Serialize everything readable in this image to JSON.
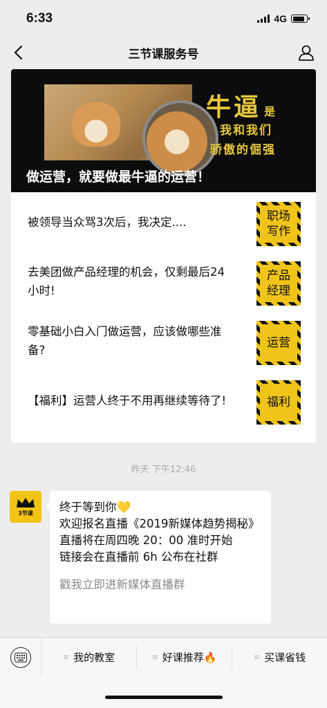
{
  "status_bar": {
    "time": "6:33",
    "network": "4G",
    "battery_level": 0.85
  },
  "nav": {
    "title": "三节课服务号",
    "back_icon": "chevron-left-icon",
    "profile_icon": "person-icon"
  },
  "banner": {
    "big_text": "牛逼",
    "shi": "是",
    "line1": "我和我们",
    "line2": "骄傲的倔强",
    "caption": "做运营，就要做最牛逼的运营！"
  },
  "articles": [
    {
      "title": "被领导当众骂3次后，我决定....",
      "thumb": "职场写作"
    },
    {
      "title": "去美团做产品经理的机会，仅剩最后24小时!",
      "thumb": "产品经理"
    },
    {
      "title": "零基础小白入门做运营，应该做哪些准备?",
      "thumb": "运营"
    },
    {
      "title": "【福利】运营人终于不用再继续等待了!",
      "thumb": "福利"
    }
  ],
  "timestamp": "昨天 下午12:46",
  "avatar": {
    "text": "3节课",
    "icon": "crown-icon"
  },
  "message": {
    "line1": "终于等到你",
    "heart": "💛",
    "line2": "欢迎报名直播《2019新媒体趋势揭秘》",
    "line3": "直播将在周四晚 20：00 准时开始",
    "line4": "链接会在直播前 6h 公布在社群",
    "link": "戳我立即进新媒体直播群"
  },
  "menu": {
    "keyboard_icon": "keyboard-icon",
    "items": [
      {
        "label": "我的教室"
      },
      {
        "label": "好课推荐🔥"
      },
      {
        "label": "买课省钱"
      }
    ],
    "item_glyph": "≡"
  }
}
